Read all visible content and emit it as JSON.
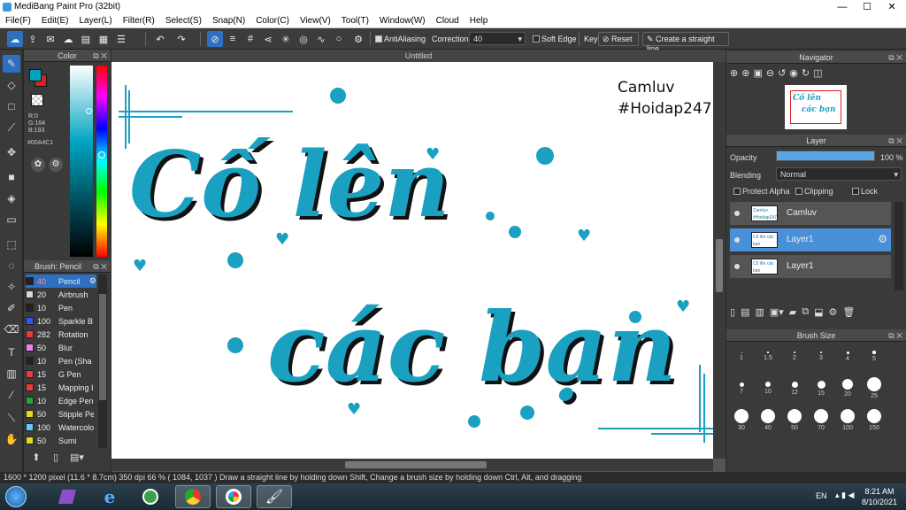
{
  "window": {
    "title": "MediBang Paint Pro (32bit)",
    "minimize": "—",
    "maximize": "☐",
    "close": "✕"
  },
  "menu": [
    "File(F)",
    "Edit(E)",
    "Layer(L)",
    "Filter(R)",
    "Select(S)",
    "Snap(N)",
    "Color(C)",
    "View(V)",
    "Tool(T)",
    "Window(W)",
    "Cloud",
    "Help"
  ],
  "toolbar": {
    "antialiasing": "AntiAliasing",
    "correction_label": "Correction",
    "correction_value": "40",
    "soft_edge": "Soft Edge",
    "key_label": "Key",
    "reset": "Reset",
    "straight_line": "Create a straight line"
  },
  "color_panel": {
    "title": "Color",
    "fg_color": "#00A4C1",
    "r": "R:0",
    "g": "G:164",
    "b": "B:193",
    "hex": "#00A4C1"
  },
  "brush_panel": {
    "title": "Brush: Pencil",
    "items": [
      {
        "size": "40",
        "name": "Pencil",
        "color": "#222222"
      },
      {
        "size": "20",
        "name": "Airbrush",
        "color": "#d8d8d8"
      },
      {
        "size": "10",
        "name": "Pen",
        "color": "#222222"
      },
      {
        "size": "100",
        "name": "Sparkle B",
        "color": "#3355ee"
      },
      {
        "size": "282",
        "name": "Rotation",
        "color": "#e83a3a"
      },
      {
        "size": "50",
        "name": "Blur",
        "color": "#f080f0"
      },
      {
        "size": "10",
        "name": "Pen (Sha",
        "color": "#222222"
      },
      {
        "size": "15",
        "name": "G Pen",
        "color": "#e83a3a"
      },
      {
        "size": "15",
        "name": "Mapping I",
        "color": "#e83a3a"
      },
      {
        "size": "10",
        "name": "Edge Pen",
        "color": "#22aa33"
      },
      {
        "size": "50",
        "name": "Stipple Pe",
        "color": "#e8d820"
      },
      {
        "size": "100",
        "name": "Watercolo",
        "color": "#66ccff"
      },
      {
        "size": "50",
        "name": "Sumi",
        "color": "#e8d820"
      }
    ]
  },
  "canvas": {
    "tab_title": "Untitled",
    "sign_line1": "Camluv",
    "sign_line2": "#Hoidap247",
    "line1": "Cố lên",
    "line2": "các bạn",
    "accent": "#1aa0c0"
  },
  "navigator": {
    "title": "Navigator",
    "thumb_line1": "Cố lên",
    "thumb_line2": "các bạn"
  },
  "layer_panel": {
    "title": "Layer",
    "opacity_label": "Opacity",
    "opacity_value": "100 %",
    "opacity_fraction": 1.0,
    "blending_label": "Blending",
    "blending_value": "Normal",
    "protect_alpha": "Protect Alpha",
    "clipping": "Clipping",
    "lock": "Lock",
    "layers": [
      {
        "name": "Camluv",
        "thumb": "Camluv #Hoidap247",
        "selected": false
      },
      {
        "name": "Layer1",
        "thumb": "Cố lên các bạn",
        "selected": true
      },
      {
        "name": "Layer1",
        "thumb": "Cố lên các bạn",
        "selected": false
      }
    ]
  },
  "brush_size_panel": {
    "title": "Brush Size",
    "sizes": [
      "1",
      "1.5",
      "2",
      "3",
      "4",
      "5",
      "7",
      "10",
      "12",
      "15",
      "20",
      "25",
      "30",
      "40",
      "50",
      "70",
      "100",
      "150"
    ]
  },
  "status": {
    "text": "1600 * 1200 pixel   (11.6 * 8.7cm)   350 dpi   66 %   ( 1084, 1037 )   Draw a straight line by holding down Shift, Change a brush size by holding down Ctrl, Alt, and dragging"
  },
  "taskbar": {
    "lang": "EN",
    "time": "8:21 AM",
    "date": "8/10/2021"
  }
}
